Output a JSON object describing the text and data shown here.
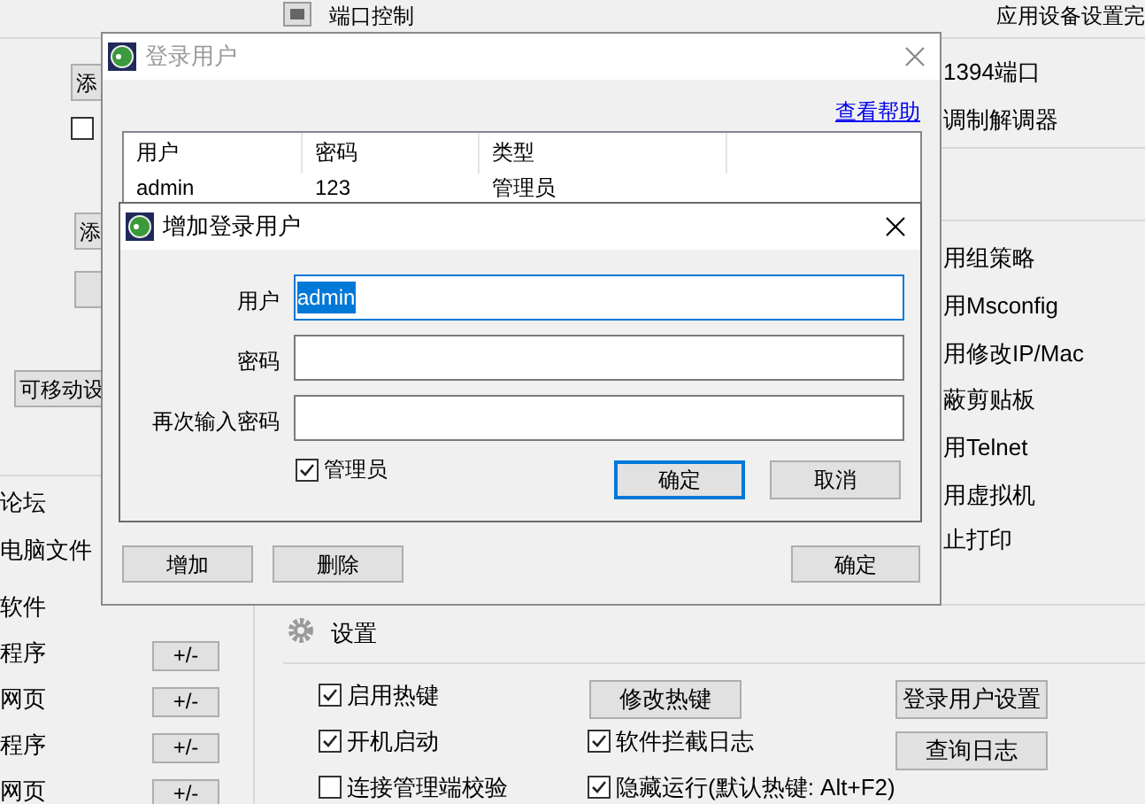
{
  "background": {
    "port_title": "端口控制",
    "top_right": "应用设备设置完",
    "left_buttons": [
      {
        "kind": "text",
        "label": "添"
      },
      {
        "kind": "text",
        "label": "添"
      },
      {
        "kind": "blank"
      },
      {
        "kind": "text",
        "label": "可移动设"
      }
    ],
    "left_checkbox": {
      "checked": false
    },
    "right_options": [
      "1394端口",
      "调制解调器",
      "用组策略",
      "用Msconfig",
      "用修改IP/Mac",
      "蔽剪贴板",
      "用Telnet",
      "用虚拟机",
      "止打印"
    ],
    "left_items": [
      {
        "label": "论坛"
      },
      {
        "label": "电脑文件"
      },
      {
        "label": "软件"
      },
      {
        "label": "程序",
        "button": "+/-"
      },
      {
        "label": "网页",
        "button": "+/-"
      },
      {
        "label": "程序",
        "button": "+/-"
      },
      {
        "label": "网页",
        "button": "+/-"
      }
    ],
    "settings": {
      "title": "设置",
      "options": [
        {
          "label": "启用热键",
          "checked": true
        },
        {
          "label": "开机启动",
          "checked": true
        },
        {
          "label": "连接管理端校验",
          "checked": false
        },
        {
          "label": "软件拦截日志",
          "checked": true
        },
        {
          "label": "隐藏运行(默认热键: Alt+F2)",
          "checked": true
        }
      ],
      "buttons": [
        "修改热键",
        "登录用户设置",
        "查询日志"
      ]
    }
  },
  "login_dialog": {
    "title": "登录用户",
    "active": false,
    "help_link": "查看帮助",
    "columns": [
      "用户",
      "密码",
      "类型"
    ],
    "rows": [
      [
        "admin",
        "123",
        "管理员"
      ]
    ],
    "buttons": [
      "增加",
      "删除",
      "确定"
    ]
  },
  "add_dialog": {
    "title": "增加登录用户",
    "active": true,
    "fields": [
      {
        "label": "用户",
        "value": "admin",
        "focused": true
      },
      {
        "label": "密码",
        "focused": false
      },
      {
        "label": "再次输入密码",
        "focused": false
      }
    ],
    "admin_checkbox": {
      "label": "管理员",
      "checked": true
    },
    "buttons": [
      {
        "label": "确定",
        "default": true
      },
      {
        "label": "取消",
        "default": false
      }
    ]
  }
}
